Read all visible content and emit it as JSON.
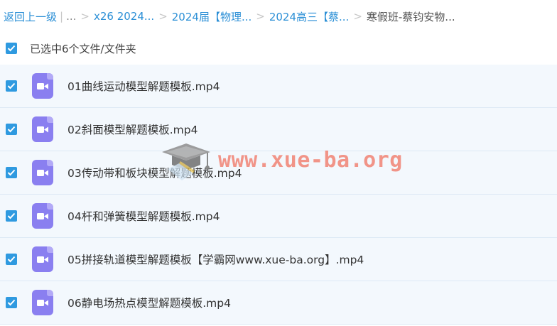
{
  "breadcrumb": {
    "back_label": "返回上一级",
    "ellipsis": "...",
    "items": [
      "x26 2024...",
      "2024届【物理...",
      "2024高三【蔡..."
    ],
    "current": "寒假班-蔡钧安物..."
  },
  "selection": {
    "label": "已选中6个文件/文件夹",
    "checked": true
  },
  "files": [
    {
      "name": "01曲线运动模型解题模板.mp4",
      "checked": true,
      "icon": "video-file-icon"
    },
    {
      "name": "02斜面模型解题模板.mp4",
      "checked": true,
      "icon": "video-file-icon"
    },
    {
      "name": "03传动带和板块模型解题模板.mp4",
      "checked": true,
      "icon": "video-file-icon"
    },
    {
      "name": "04杆和弹簧模型解题模板.mp4",
      "checked": true,
      "icon": "video-file-icon"
    },
    {
      "name": "05拼接轨道模型解题模板【学霸网www.xue-ba.org】.mp4",
      "checked": true,
      "icon": "video-file-icon"
    },
    {
      "name": "06静电场热点模型解题模板.mp4",
      "checked": true,
      "icon": "video-file-icon"
    }
  ],
  "watermark": {
    "text": "www.xue-ba.org",
    "icon": "graduation-cap-icon"
  },
  "colors": {
    "accent": "#2f9ae0",
    "link": "#2b8fd6",
    "icon": "#8a7ff0",
    "row_bg": "#f3f8fd",
    "watermark": "#f06e5a"
  }
}
